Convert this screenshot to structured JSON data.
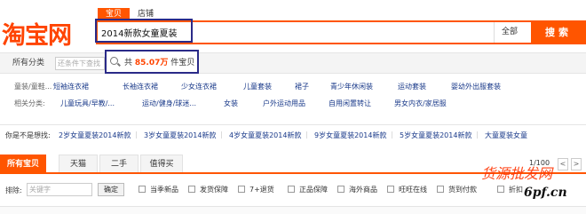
{
  "logo": {
    "text": "淘宝网",
    "color": "#ff4400"
  },
  "search": {
    "tabs": [
      "宝贝",
      "店铺"
    ],
    "query": "2014新款女童夏装",
    "scope": "全部",
    "button": "搜索",
    "accent": "#ff5500"
  },
  "category_bar": {
    "all_categories": "所有分类",
    "filter_placeholder": "还条件下查找",
    "result_prefix": "共",
    "result_count": "85.07万",
    "result_suffix": "件宝贝"
  },
  "categories": [
    {
      "label": "童装/童鞋...",
      "items": [
        "短袖连衣裙",
        "长袖连衣裙",
        "少女连衣裙",
        "儿童套装",
        "裙子",
        "青少年休闲装",
        "运动套装",
        "婴幼外出服套装"
      ]
    },
    {
      "label": "相关分类:",
      "items": [
        "儿童玩具/早教/...",
        "运动/健身/球迷...",
        "女装",
        "户外运动用品",
        "自用闲置转让",
        "男女内衣/家居服"
      ]
    }
  ],
  "recommend": {
    "label": "你是不是想找:",
    "items": [
      "2岁女童夏装2014新款",
      "3岁女童夏装2014新款",
      "4岁女童夏装2014新款",
      "9岁女童夏装2014新款",
      "5岁女童夏装2014新款",
      "大童夏装女童"
    ]
  },
  "main_tabs": [
    "所有宝贝",
    "天猫",
    "二手",
    "值得买"
  ],
  "pager": "1/100",
  "filters": {
    "exclude_label": "排除:",
    "exclude_placeholder": "关键字",
    "confirm": "确定",
    "checkboxes": [
      "当季新品",
      "发货保障",
      "7+退货",
      "正品保障",
      "海外商品",
      "旺旺在线",
      "货到付款",
      "折扣"
    ]
  },
  "watermark": {
    "line1": "货源批发网",
    "line2": "6pf.cn"
  }
}
